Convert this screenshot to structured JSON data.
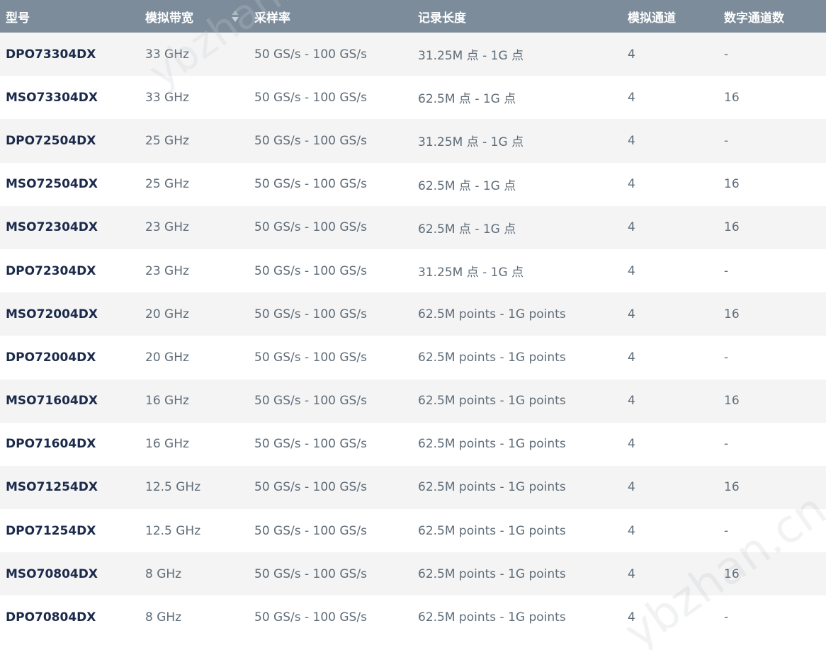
{
  "table": {
    "headers": [
      "型号",
      "模拟带宽",
      "采样率",
      "记录长度",
      "模拟通道",
      "数字通道数"
    ],
    "sorted_column": "模拟带宽",
    "rows": [
      [
        "DPO73304DX",
        "33 GHz",
        "50 GS/s - 100 GS/s",
        "31.25M 点 - 1G 点",
        "4",
        "-"
      ],
      [
        "MSO73304DX",
        "33 GHz",
        "50 GS/s - 100 GS/s",
        "62.5M 点 - 1G 点",
        "4",
        "16"
      ],
      [
        "DPO72504DX",
        "25 GHz",
        "50 GS/s - 100 GS/s",
        "31.25M 点 - 1G 点",
        "4",
        "-"
      ],
      [
        "MSO72504DX",
        "25 GHz",
        "50 GS/s - 100 GS/s",
        "62.5M 点 - 1G 点",
        "4",
        "16"
      ],
      [
        "MSO72304DX",
        "23 GHz",
        "50 GS/s - 100 GS/s",
        "62.5M 点 - 1G 点",
        "4",
        "16"
      ],
      [
        "DPO72304DX",
        "23 GHz",
        "50 GS/s - 100 GS/s",
        "31.25M 点 - 1G 点",
        "4",
        "-"
      ],
      [
        "MSO72004DX",
        "20 GHz",
        "50 GS/s - 100 GS/s",
        "62.5M points - 1G points",
        "4",
        "16"
      ],
      [
        "DPO72004DX",
        "20 GHz",
        "50 GS/s - 100 GS/s",
        "62.5M points - 1G points",
        "4",
        "-"
      ],
      [
        "MSO71604DX",
        "16 GHz",
        "50 GS/s - 100 GS/s",
        "62.5M points - 1G points",
        "4",
        "16"
      ],
      [
        "DPO71604DX",
        "16 GHz",
        "50 GS/s - 100 GS/s",
        "62.5M points - 1G points",
        "4",
        "-"
      ],
      [
        "MSO71254DX",
        "12.5 GHz",
        "50 GS/s - 100 GS/s",
        "62.5M points - 1G points",
        "4",
        "16"
      ],
      [
        "DPO71254DX",
        "12.5 GHz",
        "50 GS/s - 100 GS/s",
        "62.5M points - 1G points",
        "4",
        "-"
      ],
      [
        "MSO70804DX",
        "8 GHz",
        "50 GS/s - 100 GS/s",
        "62.5M points - 1G points",
        "4",
        "16"
      ],
      [
        "DPO70804DX",
        "8 GHz",
        "50 GS/s - 100 GS/s",
        "62.5M points - 1G points",
        "4",
        "-"
      ]
    ]
  },
  "watermark": {
    "text_top": "ybzhan.cn",
    "text_bottom": "ybzhan.cn"
  },
  "colors": {
    "header_bg": "#7c8c9a",
    "header_text": "#ffffff",
    "row_odd": "#f4f4f4",
    "row_even": "#ffffff",
    "model_text": "#1b2a4a",
    "cell_text": "#5f6c78"
  },
  "icons": {
    "sort": "sort-arrows-icon"
  }
}
